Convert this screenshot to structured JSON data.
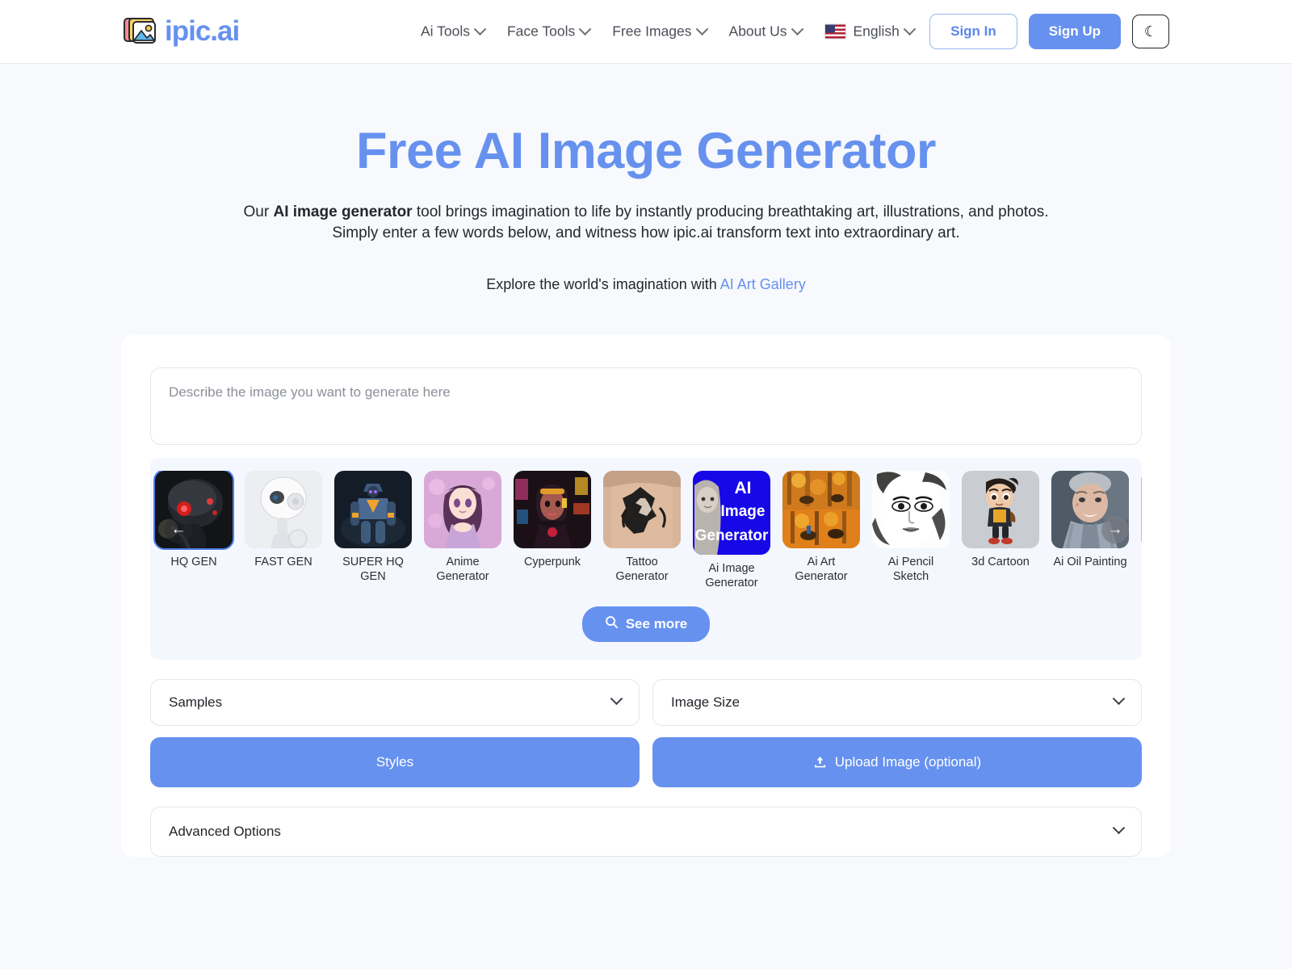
{
  "header": {
    "brand_name": "ipic.ai",
    "brand_color": "#6691ef",
    "logo_icon": "image-stack-icon",
    "nav": [
      {
        "label": "Ai Tools",
        "icon": "chevron-down-icon"
      },
      {
        "label": "Face Tools",
        "icon": "chevron-down-icon"
      },
      {
        "label": "Free Images",
        "icon": "chevron-down-icon"
      },
      {
        "label": "About Us",
        "icon": "chevron-down-icon"
      }
    ],
    "language": {
      "label": "English",
      "flag": "us-flag-icon",
      "icon": "chevron-down-icon"
    },
    "sign_in": "Sign In",
    "sign_up": "Sign Up",
    "theme_toggle_icon": "moon-icon",
    "theme_toggle_glyph": "☾"
  },
  "hero": {
    "title": "Free AI Image Generator",
    "subtitle_pre": "Our ",
    "subtitle_bold": "AI image generator",
    "subtitle_post": " tool brings imagination to life by instantly producing breathtaking art, illustrations, and photos.",
    "subtitle_line2": "Simply enter a few words below, and witness how ipic.ai transform text into extraordinary art.",
    "explore_text": "Explore the world's imagination with ",
    "explore_link": "AI Art Gallery"
  },
  "generator": {
    "prompt_placeholder": "Describe the image you want to generate here",
    "prompt_value": "",
    "prev_arrow": "←",
    "next_arrow": "→",
    "see_more": "See more",
    "see_more_icon": "search-icon",
    "samples_label": "Samples",
    "image_size_label": "Image Size",
    "styles_label": "Styles",
    "upload_label": "Upload Image (optional)",
    "upload_icon": "upload-icon",
    "advanced_options_label": "Advanced Options",
    "accent_color": "#6691ef",
    "selected_index": 0,
    "thumbnails": [
      {
        "label": "HQ GEN",
        "selected": true,
        "art": "dark-robot-head"
      },
      {
        "label": "FAST GEN",
        "selected": false,
        "art": "white-robot"
      },
      {
        "label": "SUPER HQ\nGEN",
        "selected": false,
        "art": "blue-mech"
      },
      {
        "label": "Anime\nGenerator",
        "selected": false,
        "art": "anime-girl"
      },
      {
        "label": "Cyperpunk",
        "selected": false,
        "art": "cyberpunk-girl"
      },
      {
        "label": "Tattoo\nGenerator",
        "selected": false,
        "art": "wolf-tattoo"
      },
      {
        "label": "Ai Image\nGenerator",
        "selected": false,
        "art": "ai-image-generator-poster",
        "tall": true
      },
      {
        "label": "Ai Art\nGenerator",
        "selected": false,
        "art": "autumn-painting"
      },
      {
        "label": "Ai Pencil\nSketch",
        "selected": false,
        "art": "pencil-portrait"
      },
      {
        "label": "3d Cartoon",
        "selected": false,
        "art": "3d-cartoon-boy"
      },
      {
        "label": "Ai Oil Painting",
        "selected": false,
        "art": "oil-portrait-woman"
      },
      {
        "label": "",
        "selected": false,
        "art": "partial-next"
      }
    ],
    "poster_text_lines": [
      "AI",
      "Image",
      "Generator"
    ]
  }
}
